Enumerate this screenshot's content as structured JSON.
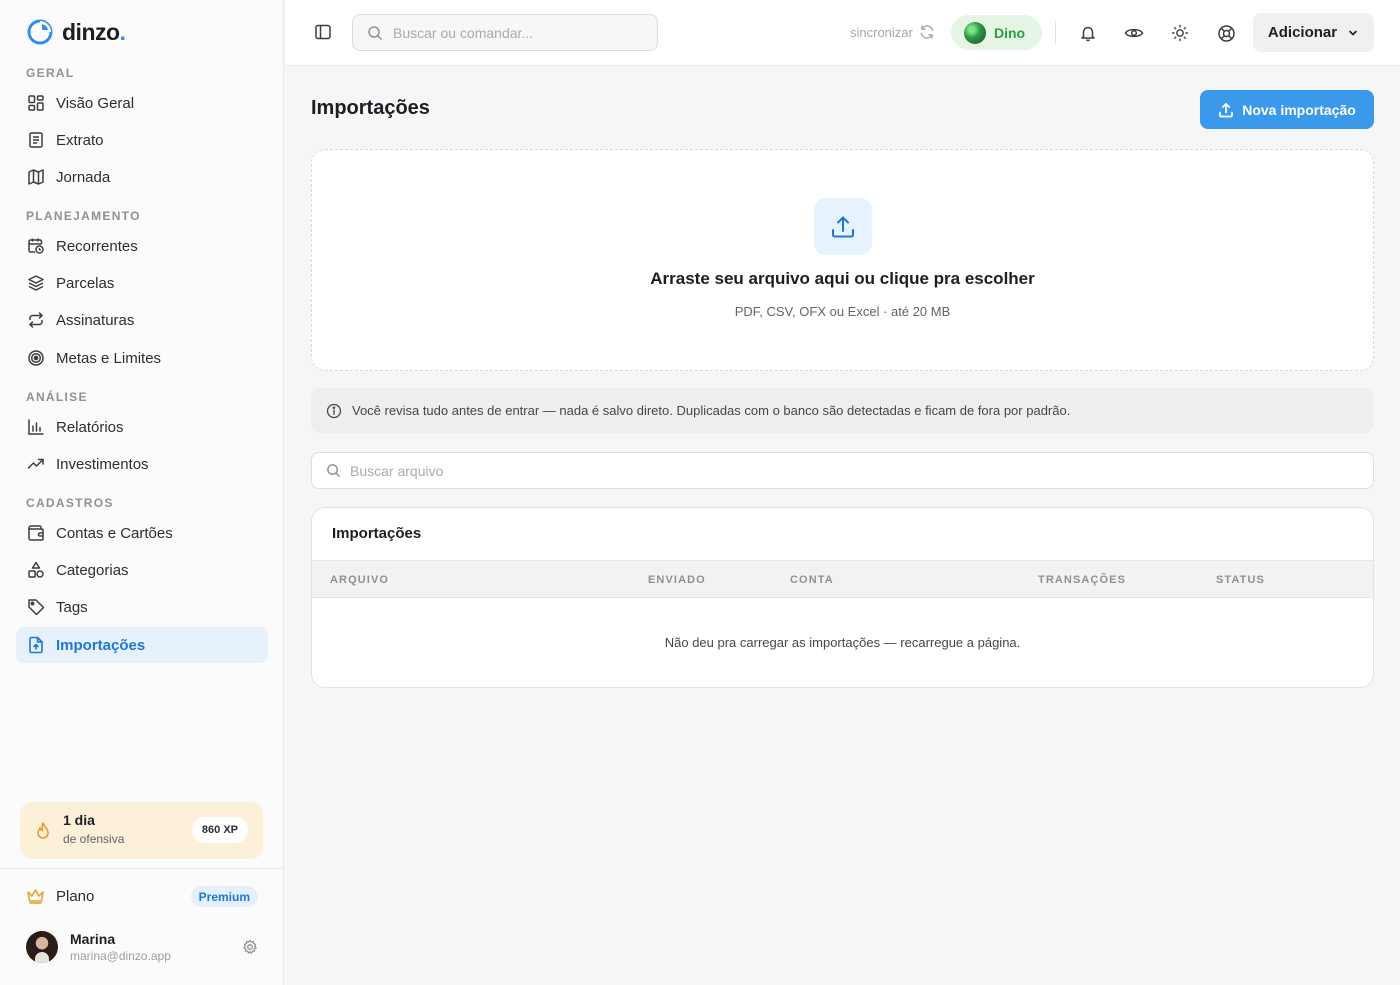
{
  "app": {
    "logo_text": "dinzo",
    "logo_dot": "."
  },
  "sidebar": {
    "sections": {
      "geral": "GERAL",
      "planejamento": "PLANEJAMENTO",
      "analise": "ANÁLISE",
      "cadastros": "CADASTROS"
    },
    "items": [
      {
        "label": "Visão Geral",
        "icon": "grid-icon"
      },
      {
        "label": "Extrato",
        "icon": "receipt-icon"
      },
      {
        "label": "Jornada",
        "icon": "map-icon"
      },
      {
        "label": "Recorrentes",
        "icon": "calendar-clock-icon"
      },
      {
        "label": "Parcelas",
        "icon": "layers-icon"
      },
      {
        "label": "Assinaturas",
        "icon": "repeat-icon"
      },
      {
        "label": "Metas e Limites",
        "icon": "target-icon"
      },
      {
        "label": "Relatórios",
        "icon": "bar-chart-icon"
      },
      {
        "label": "Investimentos",
        "icon": "trending-up-icon"
      },
      {
        "label": "Contas e Cartões",
        "icon": "wallet-icon"
      },
      {
        "label": "Categorias",
        "icon": "shapes-icon"
      },
      {
        "label": "Tags",
        "icon": "tag-icon"
      },
      {
        "label": "Importações",
        "icon": "file-upload-icon",
        "active": true
      }
    ],
    "streak": {
      "title": "1 dia",
      "subtitle": "de ofensiva",
      "xp": "860 XP"
    },
    "plan": {
      "label": "Plano",
      "badge": "Premium"
    },
    "user": {
      "name": "Marina",
      "email": "marina@dinzo.app"
    }
  },
  "topbar": {
    "search_placeholder": "Buscar ou comandar...",
    "sync_label": "sincronizar",
    "assistant_label": "Dino",
    "add_label": "Adicionar"
  },
  "main": {
    "title": "Importações",
    "new_button": "Nova importação",
    "dropzone": {
      "title": "Arraste seu arquivo aqui ou clique pra escolher",
      "subtitle": "PDF, CSV, OFX ou Excel · até 20 MB"
    },
    "notice": "Você revisa tudo antes de entrar — nada é salvo direto. Duplicadas com o banco são detectadas e ficam de fora por padrão.",
    "file_search_placeholder": "Buscar arquivo",
    "table": {
      "title": "Importações",
      "columns": [
        "ARQUIVO",
        "ENVIADO",
        "CONTA",
        "TRANSAÇÕES",
        "STATUS"
      ],
      "empty_message": "Não deu pra carregar as importações — recarregue a página."
    }
  },
  "colors": {
    "accent": "#3b99ec",
    "active_bg": "#e6f1fc",
    "dino_bg": "#e5f5e3",
    "streak_bg": "#fdf0d9"
  }
}
